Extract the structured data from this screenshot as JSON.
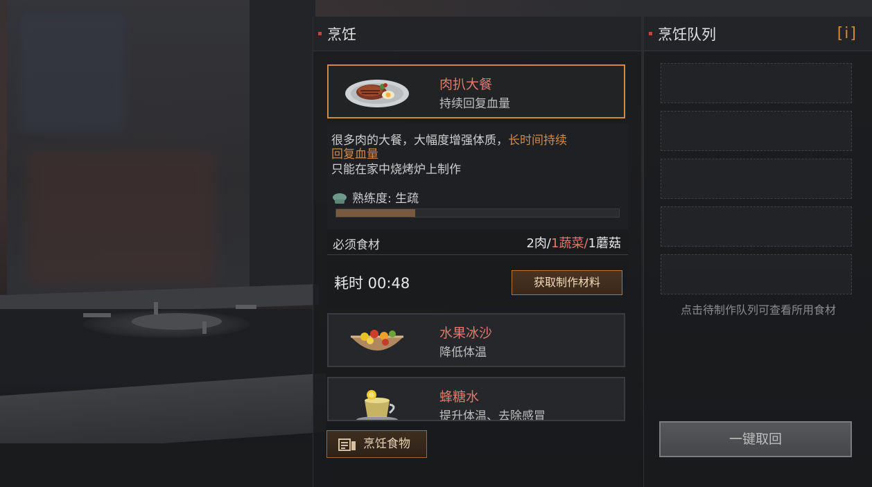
{
  "cooking_panel": {
    "title": "烹饪",
    "selected_recipe": {
      "name": "肉扒大餐",
      "effect": "持续回复血量",
      "description_line1_plain": "很多肉的大餐，大幅度增强体质，",
      "description_line1_highlight": "长时间持续",
      "description_line2_highlight": "回复血量",
      "description_line3": "只能在家中烧烤炉上制作",
      "proficiency_label": "熟练度: 生疏",
      "proficiency_progress": 0.28,
      "ingredients_label": "必须食材",
      "ingredients": {
        "part1": "2肉/",
        "part2": "1蔬菜/",
        "part3": "1蘑菇"
      },
      "time_label": "耗时 00:48",
      "get_materials_button": "获取制作材料"
    },
    "recipes": [
      {
        "name": "水果冰沙",
        "effect": "降低体温"
      },
      {
        "name": "蜂糖水",
        "effect": "提升体温、去除感冒"
      }
    ],
    "cook_food_button": "烹饪食物"
  },
  "queue_panel": {
    "title": "烹饪队列",
    "info_button": "[i]",
    "slots": 5,
    "hint": "点击待制作队列可查看所用食材",
    "retrieve_all_button": "一键取回"
  },
  "colors": {
    "accent_orange": "#d38a3c",
    "recipe_name_red": "#e07a6e",
    "highlight_text": "#d08a4a"
  }
}
